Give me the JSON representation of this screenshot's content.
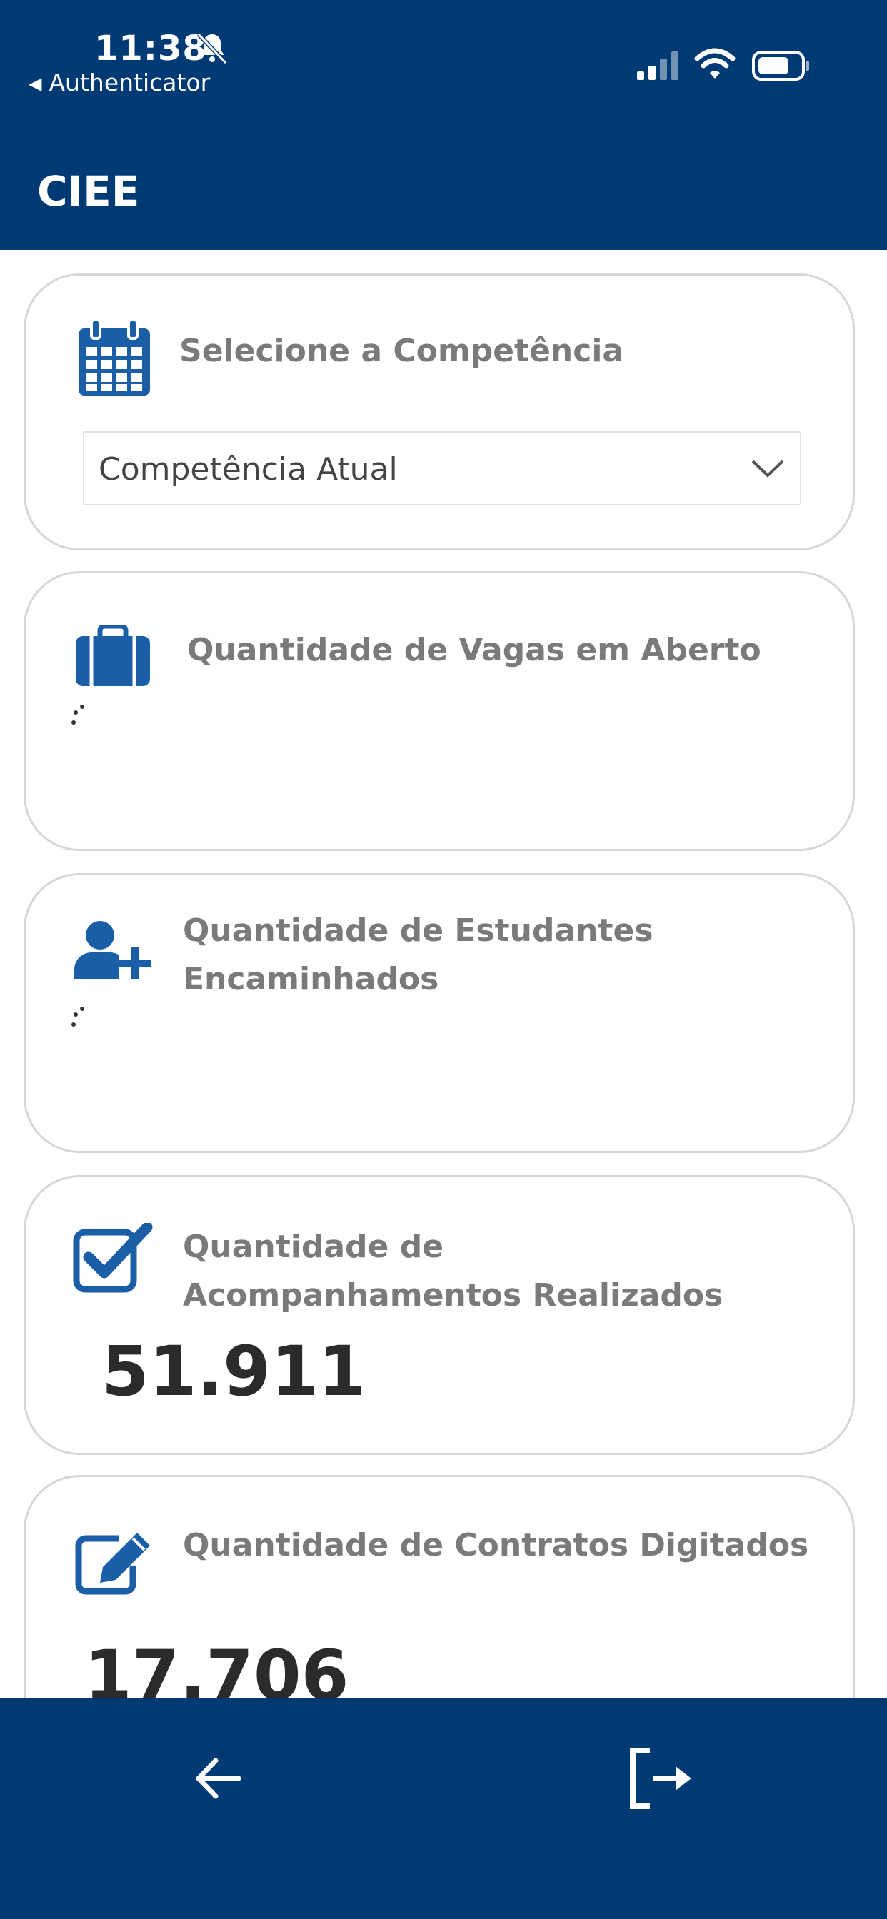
{
  "status_bar": {
    "time": "11:38",
    "back_app": "Authenticator"
  },
  "header": {
    "title": "CIEE"
  },
  "competencia": {
    "title": "Selecione a Competência",
    "selected": "Competência Atual"
  },
  "cards": [
    {
      "title": "Quantidade de Vagas em Aberto",
      "value": null
    },
    {
      "title": "Quantidade de Estudantes Encaminhados",
      "value": null
    },
    {
      "title": "Quantidade de Acompanhamentos Realizados",
      "value": "51.911"
    },
    {
      "title": "Quantidade de Contratos Digitados",
      "value": "17.706"
    }
  ],
  "icons": {
    "calendar": "calendar-icon",
    "briefcase": "briefcase-icon",
    "add_user": "add-user-icon",
    "check": "checkbox-check-icon",
    "edit": "edit-icon",
    "back": "arrow-left-icon",
    "logout": "logout-icon"
  },
  "colors": {
    "brand": "#003a74",
    "icon": "#1a5ea8",
    "title_text": "#7a7a7a"
  }
}
